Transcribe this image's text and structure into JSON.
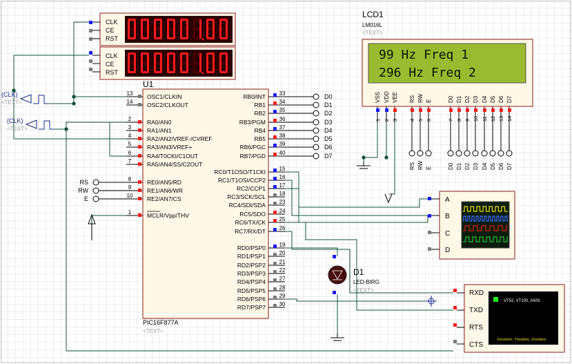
{
  "counters": [
    {
      "pins": [
        "CLK",
        "CE",
        "RST"
      ],
      "display": "00000100"
    },
    {
      "pins": [
        "CLK",
        "CE",
        "RST"
      ],
      "display": "00000100"
    }
  ],
  "generators": [
    {
      "label": "(CLK)",
      "text": "<TEXT>"
    },
    {
      "label": "(CLK)",
      "text": "<TEXT>"
    }
  ],
  "lcd": {
    "ref": "LCD1",
    "model": "LM016L",
    "text_placeholder": "<TEXT>",
    "line1": "99 Hz Freq 1",
    "line2": "296 Hz Freq 2",
    "pin_labels": [
      "VSS",
      "VDD",
      "VEE",
      "RS",
      "RW",
      "E",
      "D0",
      "D1",
      "D2",
      "D3",
      "D4",
      "D5",
      "D6",
      "D7"
    ],
    "pin_numbers": [
      "1",
      "2",
      "3",
      "4",
      "5",
      "6",
      "7",
      "8",
      "9",
      "10",
      "11",
      "12",
      "13",
      "14"
    ],
    "bottom_labels": [
      "RS",
      "RW",
      "E",
      "D0",
      "D1",
      "D2",
      "D3",
      "D4",
      "D5",
      "D6",
      "D7"
    ]
  },
  "mcu": {
    "ref": "U1",
    "part": "PIC16F877A",
    "text_placeholder": "<TEXT>",
    "left_pins": [
      {
        "num": "13",
        "name": "OSC1/CLKIN"
      },
      {
        "num": "14",
        "name": "OSC2/CLKOUT"
      },
      {
        "num": "2",
        "name": "RA0/AN0"
      },
      {
        "num": "3",
        "name": "RA1/AN1"
      },
      {
        "num": "4",
        "name": "RA2/AN2/VREF-/CVREF"
      },
      {
        "num": "5",
        "name": "RA3/AN3/VREF+"
      },
      {
        "num": "6",
        "name": "RA4/T0CKI/C1OUT"
      },
      {
        "num": "7",
        "name": "RA5/AN4/SS/C2OUT"
      },
      {
        "num": "8",
        "name": "RE0/AN5/RD"
      },
      {
        "num": "9",
        "name": "RE1/AN6/WR"
      },
      {
        "num": "10",
        "name": "RE2/AN7/CS"
      },
      {
        "num": "1",
        "name": "MCLR/Vpp/THV"
      }
    ],
    "right_pins": [
      {
        "num": "33",
        "name": "RB0/INT"
      },
      {
        "num": "34",
        "name": "RB1"
      },
      {
        "num": "35",
        "name": "RB2"
      },
      {
        "num": "36",
        "name": "RB3/PGM"
      },
      {
        "num": "37",
        "name": "RB4"
      },
      {
        "num": "38",
        "name": "RB5"
      },
      {
        "num": "39",
        "name": "RB6/PGC"
      },
      {
        "num": "40",
        "name": "RB7/PGD"
      },
      {
        "num": "15",
        "name": "RC0/T1OSO/T1CKI"
      },
      {
        "num": "16",
        "name": "RC1/T1OSI/CCP2"
      },
      {
        "num": "17",
        "name": "RC2/CCP1"
      },
      {
        "num": "18",
        "name": "RC3/SCK/SCL"
      },
      {
        "num": "23",
        "name": "RC4/SDI/SDA"
      },
      {
        "num": "24",
        "name": "RC5/SDO"
      },
      {
        "num": "25",
        "name": "RC6/TX/CK"
      },
      {
        "num": "26",
        "name": "RC7/RX/DT"
      },
      {
        "num": "19",
        "name": "RD0/PSP0"
      },
      {
        "num": "20",
        "name": "RD1/PSP1"
      },
      {
        "num": "21",
        "name": "RD2/PSP2"
      },
      {
        "num": "22",
        "name": "RD3/PSP3"
      },
      {
        "num": "27",
        "name": "RD4/PSP4"
      },
      {
        "num": "28",
        "name": "RD5/PSP5"
      },
      {
        "num": "29",
        "name": "RD6/PSP6"
      },
      {
        "num": "30",
        "name": "RD7/PSP7"
      }
    ]
  },
  "rb_terminals": [
    "D0",
    "D1",
    "D2",
    "D3",
    "D4",
    "D5",
    "D6",
    "D7"
  ],
  "re_terminals": [
    "RS",
    "RW",
    "E"
  ],
  "led": {
    "ref": "D1",
    "part": "LED-BIRG",
    "text_placeholder": "<TEXT>"
  },
  "scope": {
    "channels": [
      "A",
      "B",
      "C",
      "D"
    ]
  },
  "terminal": {
    "pins": [
      "RXD",
      "TXD",
      "RTS",
      "CTS"
    ],
    "title": "VT52, VT100, ANSI",
    "footer": "Xmodem, Ymodem, Zmodem"
  },
  "colors": {
    "wire": "#14503a",
    "body_fill": "#fff8e6",
    "body_stroke": "#8b1a1a",
    "lcd_bg": "#9aba30",
    "lcd_text": "#0a1500",
    "seg_on": "#ff1a1a",
    "grid": "#d8d8d8",
    "pin_blue": "#1a1aff",
    "pin_red": "#ff1a1a",
    "pin_gray": "#7a7a7a",
    "label_blue": "#1a2a8a",
    "placeholder": "#a0a0a0"
  }
}
